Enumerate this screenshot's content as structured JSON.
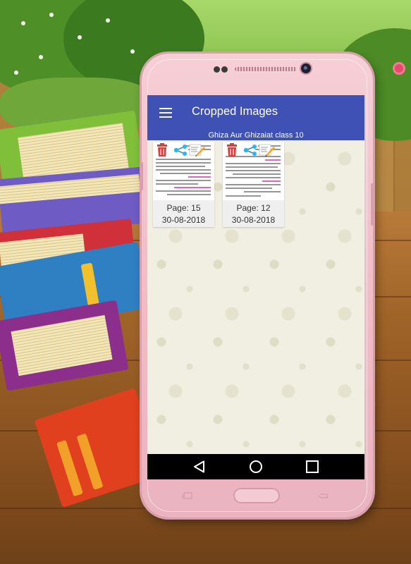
{
  "app": {
    "title": "Cropped Images",
    "subtitle": "Ghiza Aur Ghizaiat class 10",
    "accent_color": "#3f51b5"
  },
  "icons": {
    "menu": "hamburger-menu-icon",
    "delete": "trash-icon",
    "share": "share-icon",
    "edit": "edit-icon",
    "nav_back": "back-triangle-icon",
    "nav_home": "home-circle-icon",
    "nav_recents": "recents-square-icon"
  },
  "cards": [
    {
      "page": "Page: 15",
      "date": "30-08-2018"
    },
    {
      "page": "Page: 12",
      "date": "30-08-2018"
    }
  ]
}
